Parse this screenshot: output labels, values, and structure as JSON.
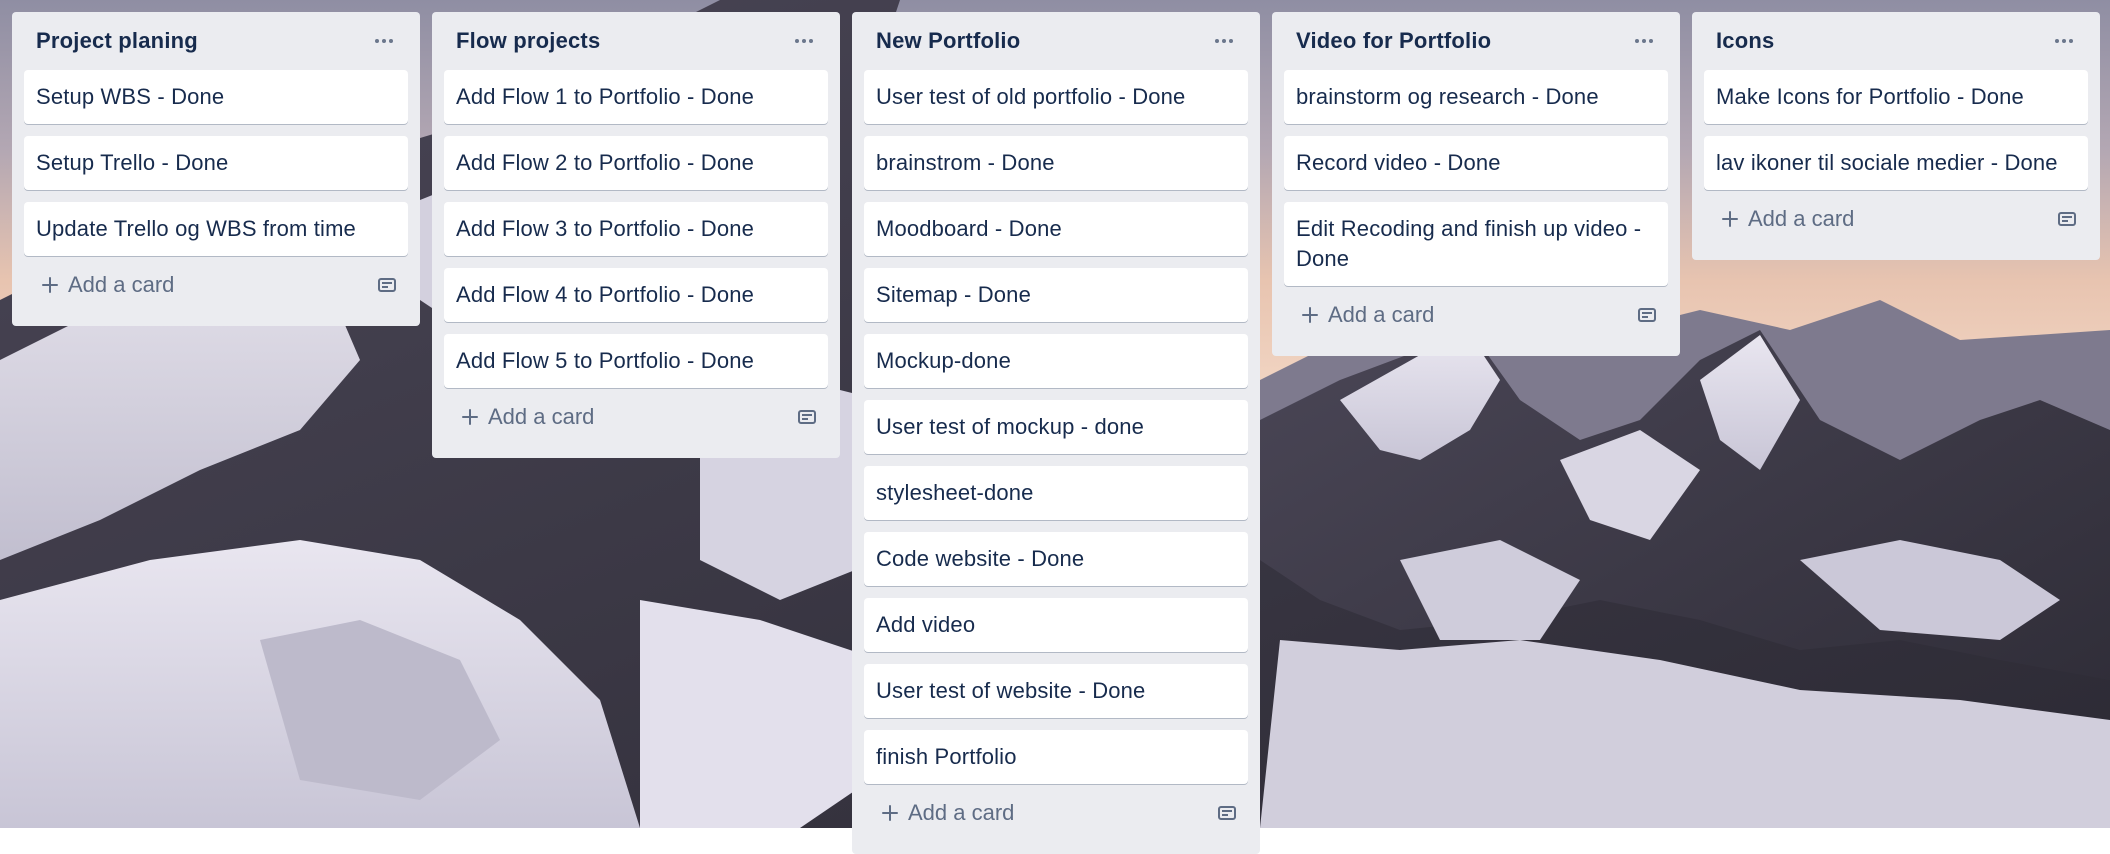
{
  "colors": {
    "list_bg": "#ebecf0",
    "card_bg": "#ffffff",
    "title_text": "#172b4d",
    "muted_text": "#5e6c84"
  },
  "lists": [
    {
      "title": "Project planing",
      "cards": [
        "Setup WBS - Done",
        "Setup Trello - Done",
        "Update Trello og WBS from time"
      ],
      "add_card_label": "Add a card"
    },
    {
      "title": "Flow projects",
      "cards": [
        "Add Flow 1 to Portfolio - Done",
        "Add Flow 2 to Portfolio - Done",
        "Add Flow 3 to Portfolio - Done",
        "Add Flow 4 to Portfolio - Done",
        "Add Flow 5 to Portfolio - Done"
      ],
      "add_card_label": "Add a card"
    },
    {
      "title": "New Portfolio",
      "cards": [
        "User test of old portfolio - Done",
        "brainstrom - Done",
        "Moodboard - Done",
        "Sitemap - Done",
        "Mockup-done",
        "User test of mockup - done",
        "stylesheet-done",
        "Code website - Done",
        "Add video",
        "User test of website - Done",
        "finish Portfolio"
      ],
      "add_card_label": "Add a card"
    },
    {
      "title": "Video for Portfolio",
      "cards": [
        "brainstorm og research - Done",
        "Record video - Done",
        "Edit Recoding and finish up video - Done"
      ],
      "add_card_label": "Add a card"
    },
    {
      "title": "Icons",
      "cards": [
        "Make Icons for Portfolio - Done",
        "lav ikoner til sociale medier - Done"
      ],
      "add_card_label": "Add a card"
    }
  ],
  "icons": {
    "list_menu": "more-horizontal-icon",
    "add": "plus-icon",
    "template": "card-template-icon"
  }
}
